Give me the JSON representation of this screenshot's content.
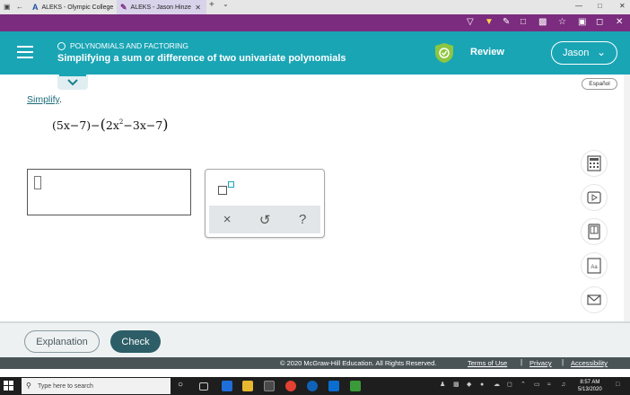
{
  "browser": {
    "tabs": [
      {
        "icon_text": "A",
        "label": "ALEKS - Olympic College"
      },
      {
        "icon_text": "✎",
        "label": "ALEKS - Jason Hinze"
      }
    ],
    "new_tab": "+",
    "tab_dropdown": "⌄",
    "window_controls": {
      "minimize": "—",
      "maximize": "□",
      "close": "✕"
    },
    "accent_color": "#7b2c7e"
  },
  "header": {
    "topic": "POLYNOMIALS AND FACTORING",
    "title": "Simplifying a sum or difference of two univariate polynomials",
    "review_label": "Review",
    "user_name": "Jason",
    "color": "#1aa5b5"
  },
  "content": {
    "language_button": "Español",
    "instruction_link": "Simplify",
    "instruction_period": ".",
    "expression": {
      "part1": "(5x−7)−",
      "open_paren": "(",
      "term1": "2x",
      "exp": "2",
      "rest": "−3x−7",
      "close_paren": ")"
    },
    "palette": {
      "clear": "×",
      "undo": "↺",
      "help": "?"
    }
  },
  "bottom": {
    "explanation_button": "Explanation",
    "check_button": "Check"
  },
  "footer": {
    "copyright": "© 2020 McGraw-Hill Education. All Rights Reserved.",
    "terms": "Terms of Use",
    "sep": "|",
    "privacy": "Privacy",
    "accessibility": "Accessibility"
  },
  "taskbar": {
    "search_placeholder": "Type here to search",
    "time": "8:57 AM",
    "date": "5/13/2020"
  }
}
